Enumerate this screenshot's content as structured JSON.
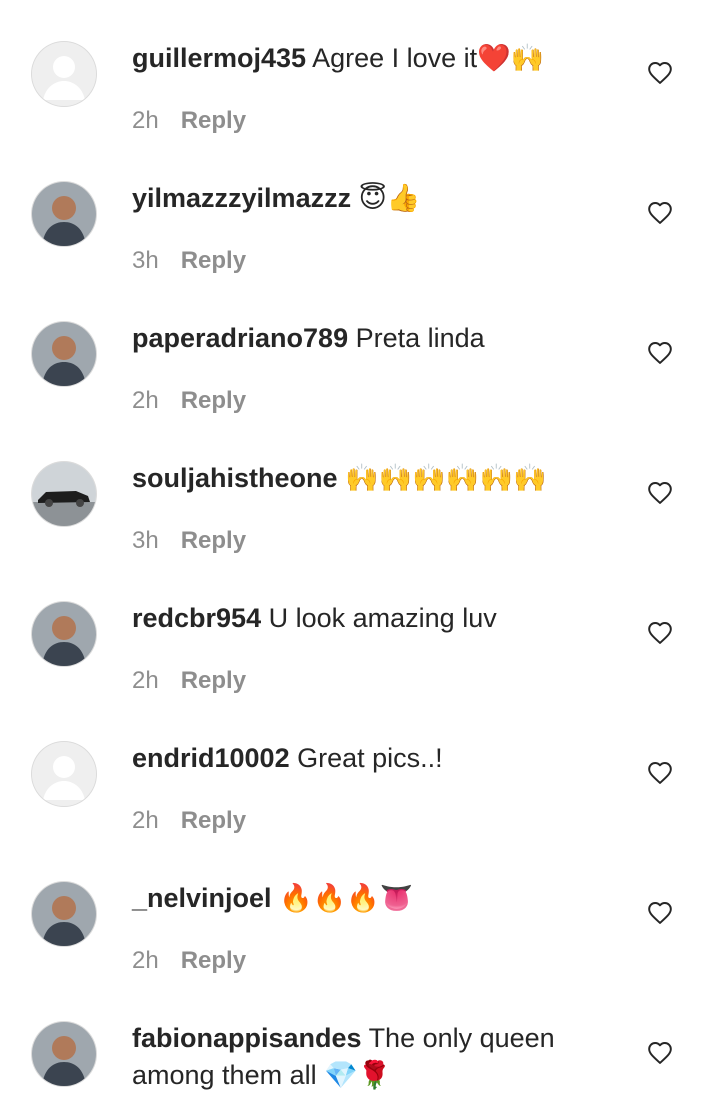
{
  "comments": [
    {
      "username": "guillermoj435",
      "text": "Agree I love it❤️🙌",
      "time": "2h",
      "reply_label": "Reply",
      "avatar": "default-avatar"
    },
    {
      "username": "yilmazzzyilmazzz",
      "text": "😇👍",
      "time": "3h",
      "reply_label": "Reply",
      "avatar": "user-photo"
    },
    {
      "username": "paperadriano789",
      "text": "Preta linda",
      "time": "2h",
      "reply_label": "Reply",
      "avatar": "user-photo"
    },
    {
      "username": "souljahistheone",
      "text": "🙌🙌🙌🙌🙌🙌",
      "time": "3h",
      "reply_label": "Reply",
      "avatar": "car-photo"
    },
    {
      "username": "redcbr954",
      "text": "U look amazing luv",
      "time": "2h",
      "reply_label": "Reply",
      "avatar": "user-photo"
    },
    {
      "username": "endrid10002",
      "text": "Great pics..!",
      "time": "2h",
      "reply_label": "Reply",
      "avatar": "default-avatar"
    },
    {
      "username": "_nelvinjoel",
      "text": "🔥🔥🔥👅",
      "time": "2h",
      "reply_label": "Reply",
      "avatar": "user-photo"
    },
    {
      "username": "fabionappisandes",
      "text": "The only queen among them all 💎🌹",
      "time": "",
      "reply_label": "",
      "avatar": "user-photo"
    }
  ],
  "icons": {
    "like": "heart-outline-icon"
  },
  "colors": {
    "username": "#262626",
    "meta": "#8e8e8e",
    "icon": "#262626"
  }
}
